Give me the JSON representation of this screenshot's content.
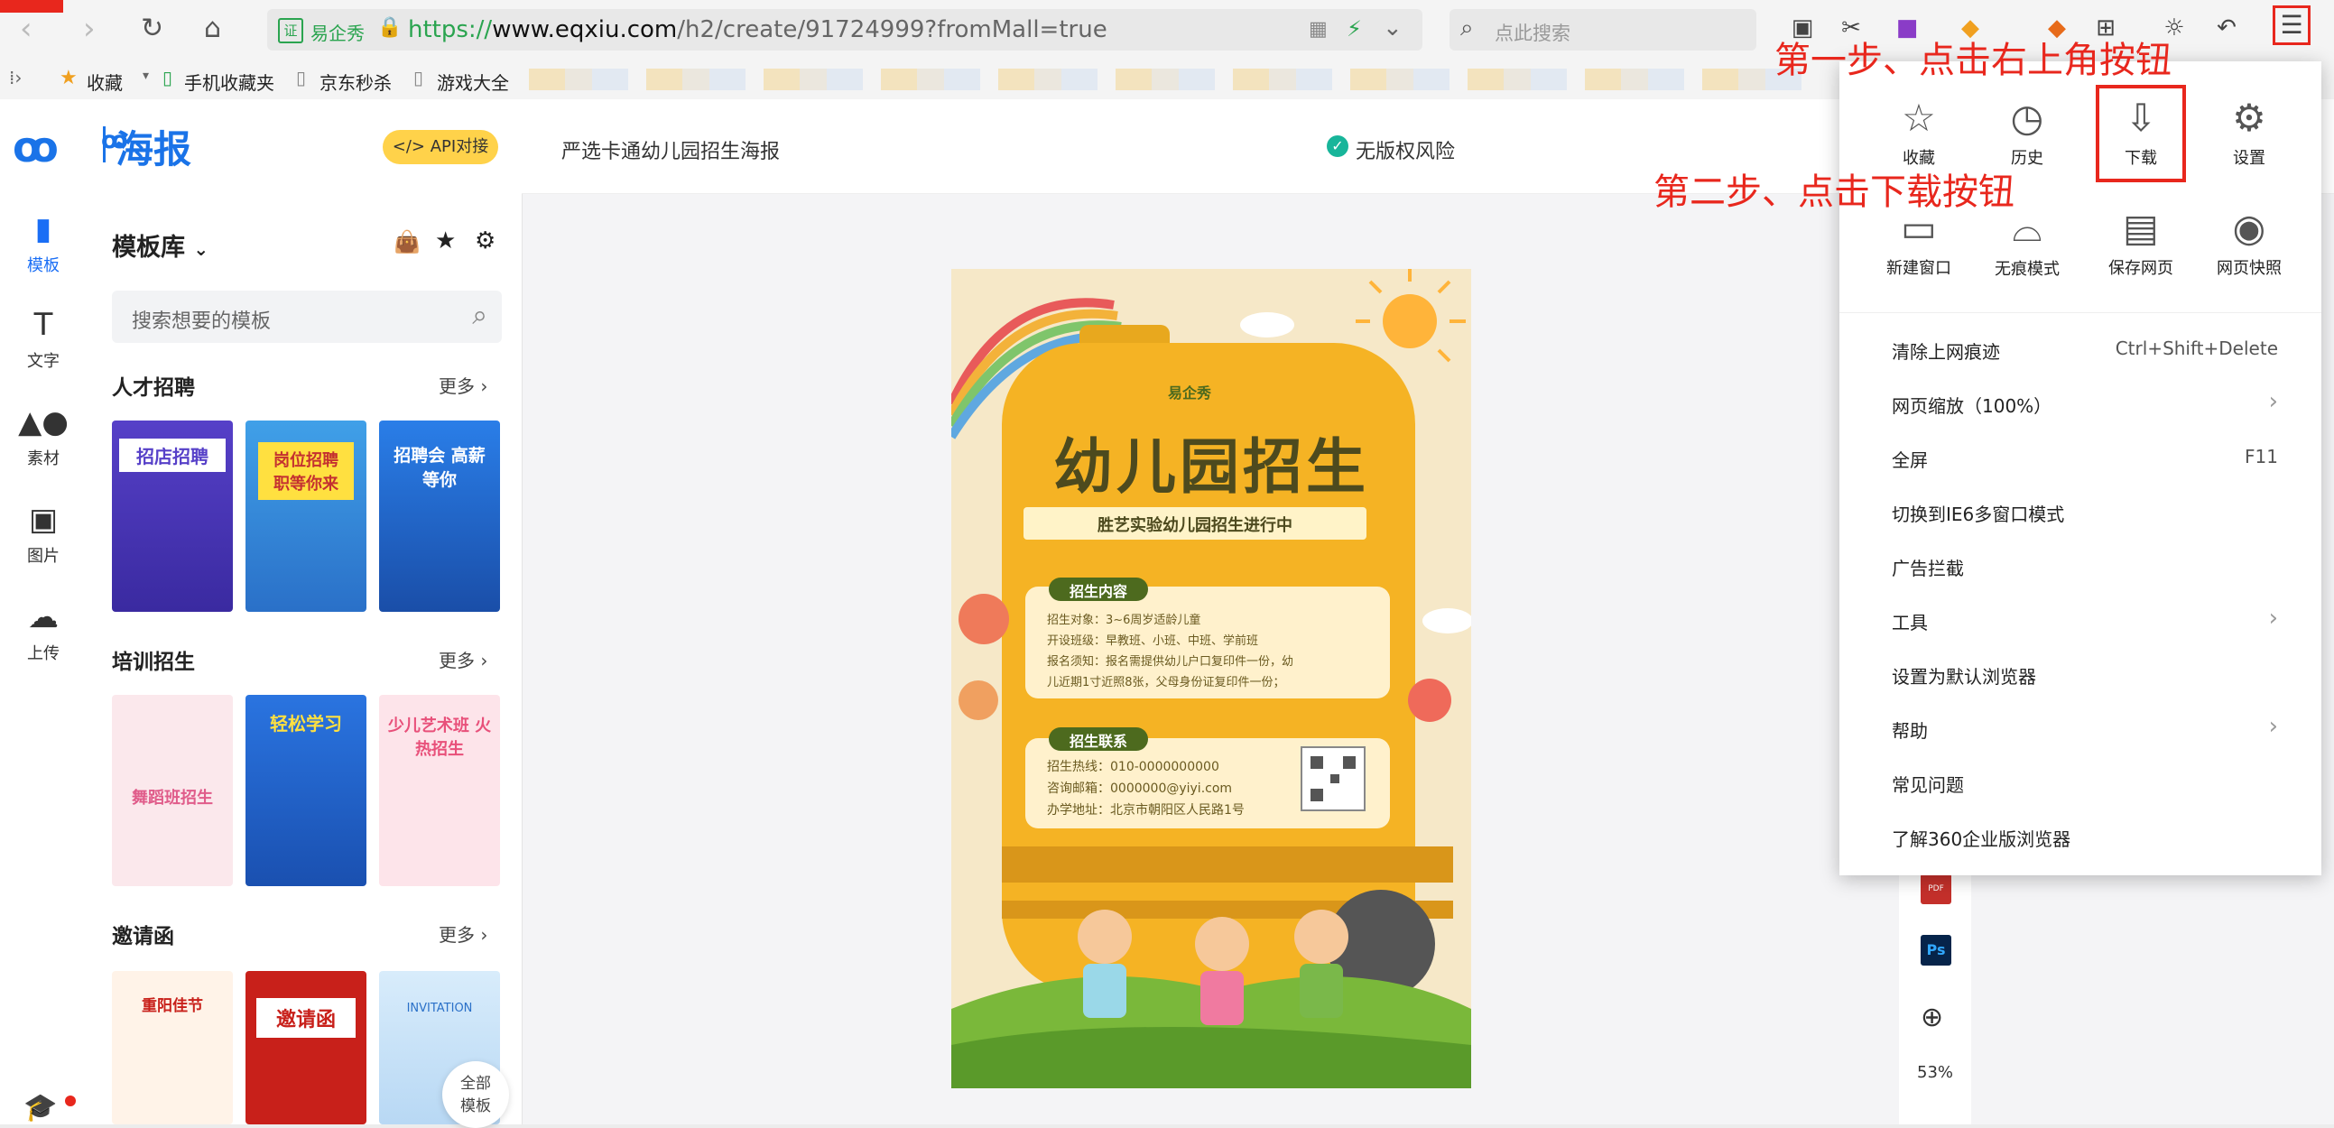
{
  "browser": {
    "url_prefix": "https://",
    "url_domain": "www.eqxiu.com",
    "url_path": "/h2/create/91724999?fromMall=true",
    "site_badge": "易企秀",
    "search_placeholder": "点此搜索",
    "bookmarks": [
      "收藏",
      "手机收藏夹",
      "京东秒杀",
      "游戏大全"
    ]
  },
  "app": {
    "logo_text": "海报",
    "api_button": "</> API对接",
    "doc_title": "严选卡通幼儿园招生海报",
    "copyright_badge": "无版权风险",
    "left_nav": [
      {
        "icon": "template-icon",
        "label": "模板"
      },
      {
        "icon": "text-icon",
        "label": "文字"
      },
      {
        "icon": "material-icon",
        "label": "素材"
      },
      {
        "icon": "image-icon",
        "label": "图片"
      },
      {
        "icon": "upload-icon",
        "label": "上传"
      }
    ],
    "panel": {
      "title": "模板库",
      "search_placeholder": "搜索想要的模板",
      "more_label": "更多",
      "sections": [
        {
          "title": "人才招聘",
          "thumbs": [
            "招店招聘",
            "岗位招聘 职等你来",
            "招聘会 高薪等你"
          ]
        },
        {
          "title": "培训招生",
          "thumbs": [
            "舞蹈班招生",
            "轻松学习",
            "少儿艺术班 火热招生"
          ]
        },
        {
          "title": "邀请函",
          "thumbs": [
            "重阳佳节",
            "邀请函",
            "INVITATION"
          ]
        }
      ],
      "all_templates": [
        "全部",
        "模板"
      ]
    },
    "right_rail": {
      "zoom": "53%",
      "ps_label": "Ps",
      "pdf_label": "PDF"
    }
  },
  "poster": {
    "brand": "易企秀",
    "title": "幼儿园招生",
    "subtitle": "胜艺实验幼儿园招生进行中",
    "section1_title": "招生内容",
    "section1_lines": [
      "招生对象：3~6周岁适龄儿童",
      "开设班级：早教班、小班、中班、学前班",
      "报名须知：报名需提供幼儿户口复印件一份，幼",
      "儿近期1寸近照8张，父母身份证复印件一份；"
    ],
    "section2_title": "招生联系",
    "section2_lines": [
      "招生热线：010-0000000000",
      "咨询邮箱：0000000@yiyi.com",
      "办学地址：北京市朝阳区人民路1号"
    ]
  },
  "menu": {
    "grid": [
      {
        "icon": "star-icon",
        "label": "收藏"
      },
      {
        "icon": "history-icon",
        "label": "历史"
      },
      {
        "icon": "download-icon",
        "label": "下载"
      },
      {
        "icon": "settings-icon",
        "label": "设置"
      },
      {
        "icon": "new-window-icon",
        "label": "新建窗口"
      },
      {
        "icon": "incognito-icon",
        "label": "无痕模式"
      },
      {
        "icon": "save-page-icon",
        "label": "保存网页"
      },
      {
        "icon": "screenshot-icon",
        "label": "网页快照"
      }
    ],
    "items": [
      {
        "label": "清除上网痕迹",
        "shortcut": "Ctrl+Shift+Delete"
      },
      {
        "label": "网页缩放（100%）",
        "shortcut": "›"
      },
      {
        "label": "全屏",
        "shortcut": "F11"
      },
      {
        "label": "切换到IE6多窗口模式",
        "shortcut": ""
      },
      {
        "label": "广告拦截",
        "shortcut": ""
      },
      {
        "label": "工具",
        "shortcut": "›"
      },
      {
        "label": "设置为默认浏览器",
        "shortcut": ""
      },
      {
        "label": "帮助",
        "shortcut": "›"
      },
      {
        "label": "常见问题",
        "shortcut": ""
      },
      {
        "label": "了解360企业版浏览器",
        "shortcut": ""
      }
    ]
  },
  "annotations": {
    "step1": "第一步、点击右上角按钮",
    "step2": "第二步、点击下载按钮",
    "color": "#e8271d"
  }
}
